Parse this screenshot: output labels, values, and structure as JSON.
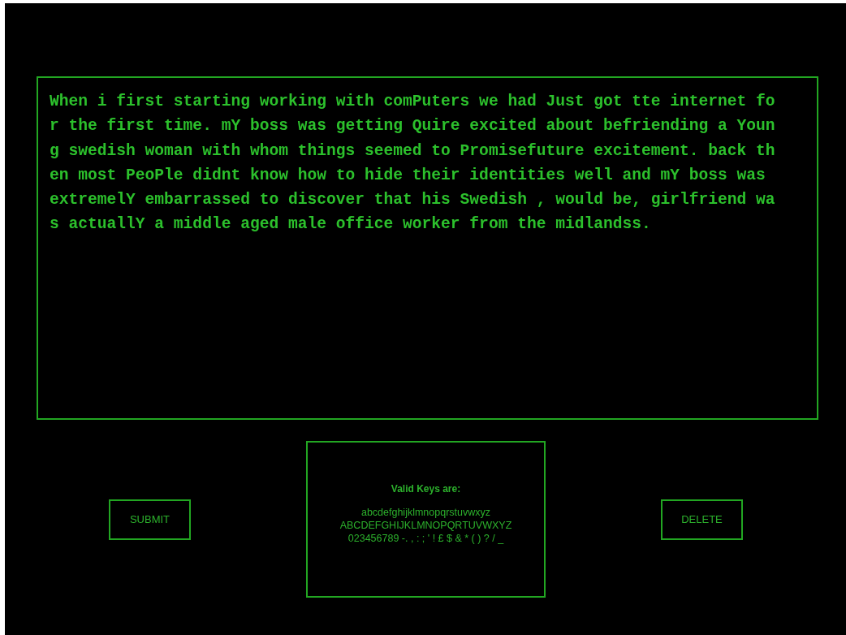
{
  "text_area": {
    "lines": [
      "When i first starting working with comPuters we had Just got tte internet fo",
      "r the first time. mY boss was getting Quire excited about befriending a Youn",
      "g swedish woman with whom things seemed to Promisefuture excitement. back th",
      "en most PeoPle didnt know how to hide their identities well and mY boss was",
      "extremelY embarrassed to discover that his Swedish , would be, girlfriend wa",
      "s actuallY a middle aged male office worker from the midlandss."
    ]
  },
  "submit_button": {
    "label": "SUBMIT"
  },
  "valid_keys": {
    "title": "Valid Keys are:",
    "lines": [
      "abcdefghijklmnopqrstuvwxyz",
      "ABCDEFGHIJKLMNOPQRTUVWXYZ",
      "023456789 -. , : ; ' ! £ $ & * ( ) ? / _"
    ]
  },
  "delete_button": {
    "label": "DELETE"
  }
}
